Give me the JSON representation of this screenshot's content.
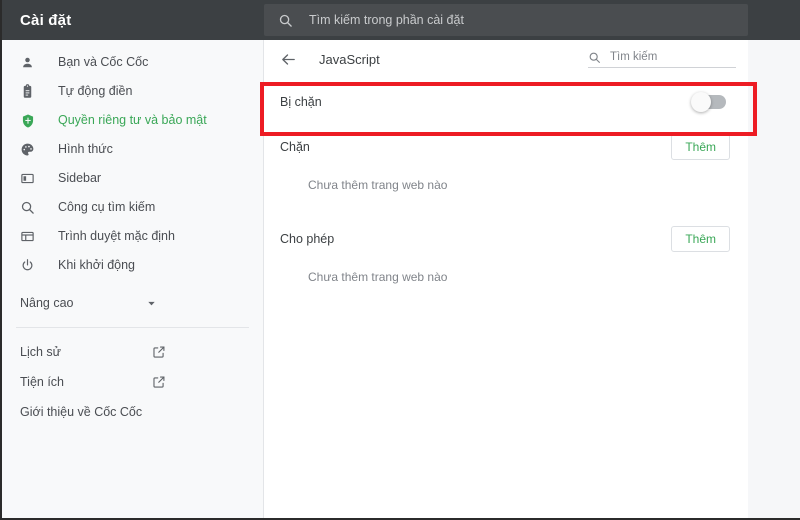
{
  "topbar": {
    "title": "Cài đặt",
    "search_placeholder": "Tìm kiếm trong phần cài đặt",
    "search_icon": "search-icon"
  },
  "sidebar": {
    "items": [
      {
        "label": "Bạn và Cốc Cốc",
        "icon": "person-icon",
        "active": false
      },
      {
        "label": "Tự động điền",
        "icon": "clipboard-icon",
        "active": false
      },
      {
        "label": "Quyền riêng tư và bảo mật",
        "icon": "shield-icon",
        "active": true
      },
      {
        "label": "Hình thức",
        "icon": "palette-icon",
        "active": false
      },
      {
        "label": "Sidebar",
        "icon": "sidebar-panel-icon",
        "active": false
      },
      {
        "label": "Công cụ tìm kiếm",
        "icon": "search-icon",
        "active": false
      },
      {
        "label": "Trình duyệt mặc định",
        "icon": "browser-window-icon",
        "active": false
      },
      {
        "label": "Khi khởi động",
        "icon": "power-icon",
        "active": false
      }
    ],
    "advanced": {
      "label": "Nâng cao",
      "icon": "chevron-down-icon"
    },
    "links": [
      {
        "label": "Lịch sử",
        "icon": "external-link-icon"
      },
      {
        "label": "Tiện ích",
        "icon": "external-link-icon"
      }
    ],
    "about": "Giới thiệu về Cốc Cốc"
  },
  "content": {
    "back_icon": "arrow-left-icon",
    "page_title": "JavaScript",
    "search_placeholder": "Tìm kiếm",
    "search_icon": "search-icon",
    "toggle": {
      "label": "Bị chặn",
      "state": "off"
    },
    "sections": [
      {
        "title": "Chặn",
        "add_label": "Thêm",
        "empty_text": "Chưa thêm trang web nào"
      },
      {
        "title": "Cho phép",
        "add_label": "Thêm",
        "empty_text": "Chưa thêm trang web nào"
      }
    ]
  },
  "colors": {
    "accent_green": "#3aa757",
    "header_dark": "#3c4043",
    "highlight_red": "#ed1c24",
    "sidebar_bg": "#f8f9fa",
    "toggle_track_off": "#b5b9bd"
  }
}
